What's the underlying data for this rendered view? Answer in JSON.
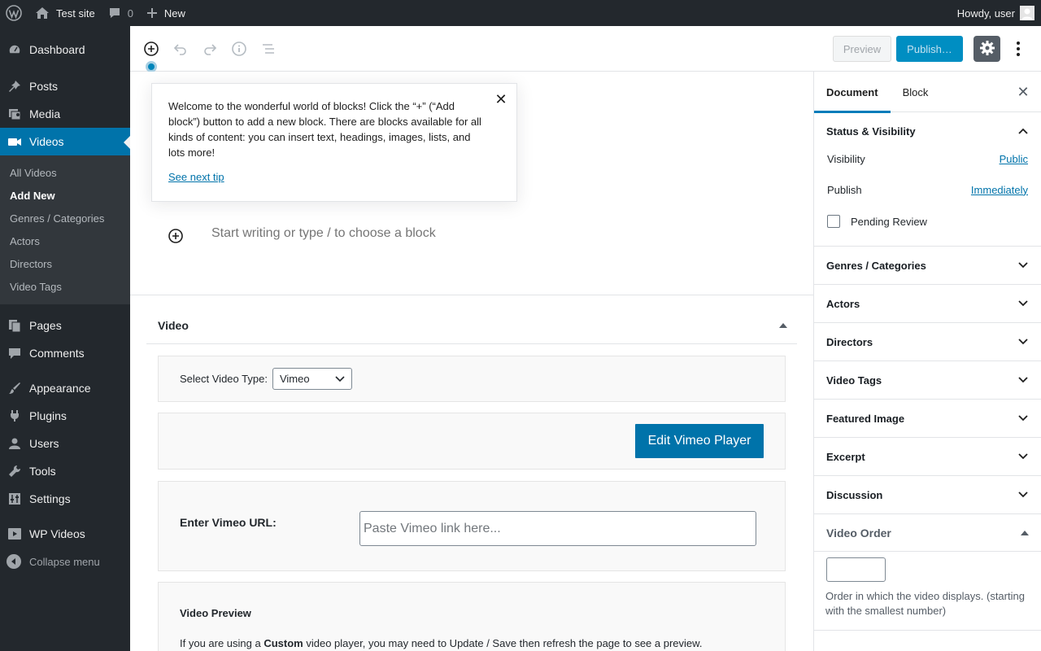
{
  "adminbar": {
    "site_name": "Test site",
    "comments_count": "0",
    "new_label": "New",
    "howdy": "Howdy, user"
  },
  "menu": {
    "dashboard": "Dashboard",
    "posts": "Posts",
    "media": "Media",
    "videos": "Videos",
    "videos_sub": [
      "All Videos",
      "Add New",
      "Genres / Categories",
      "Actors",
      "Directors",
      "Video Tags"
    ],
    "pages": "Pages",
    "comments": "Comments",
    "appearance": "Appearance",
    "plugins": "Plugins",
    "users": "Users",
    "tools": "Tools",
    "settings": "Settings",
    "wp_videos": "WP Videos",
    "collapse": "Collapse menu"
  },
  "header": {
    "preview_label": "Preview",
    "publish_label": "Publish…"
  },
  "tip": {
    "text": "Welcome to the wonderful world of blocks! Click the “+” (“Add block”) button to add a new block. There are blocks available for all kinds of content: you can insert text, headings, images, lists, and lots more!",
    "link": "See next tip",
    "close": "✕"
  },
  "editor": {
    "placeholder": "Start writing or type / to choose a block"
  },
  "video_box": {
    "title": "Video",
    "select_label": "Select Video Type:",
    "select_value": "Vimeo",
    "edit_button": "Edit Vimeo Player",
    "url_label": "Enter Vimeo URL:",
    "url_placeholder": "Paste Vimeo link here...",
    "preview_title": "Video Preview",
    "preview_text_before": "If you are using a ",
    "preview_text_bold": "Custom",
    "preview_text_after": " video player, you may need to Update / Save then refresh the page to see a preview."
  },
  "sidebar": {
    "tab_document": "Document",
    "tab_block": "Block",
    "close": "✕",
    "status_title": "Status & Visibility",
    "visibility_label": "Visibility",
    "visibility_value": "Public",
    "publish_label": "Publish",
    "publish_value": "Immediately",
    "pending_label": "Pending Review",
    "sections": [
      "Genres / Categories",
      "Actors",
      "Directors",
      "Video Tags",
      "Featured Image",
      "Excerpt",
      "Discussion"
    ],
    "video_order_title": "Video Order",
    "video_order_desc": "Order in which the video displays. (starting with the smallest number)"
  },
  "colors": {
    "admin_dark": "#23282d",
    "accent": "#0073aa",
    "publish_blue": "#008ec2"
  }
}
